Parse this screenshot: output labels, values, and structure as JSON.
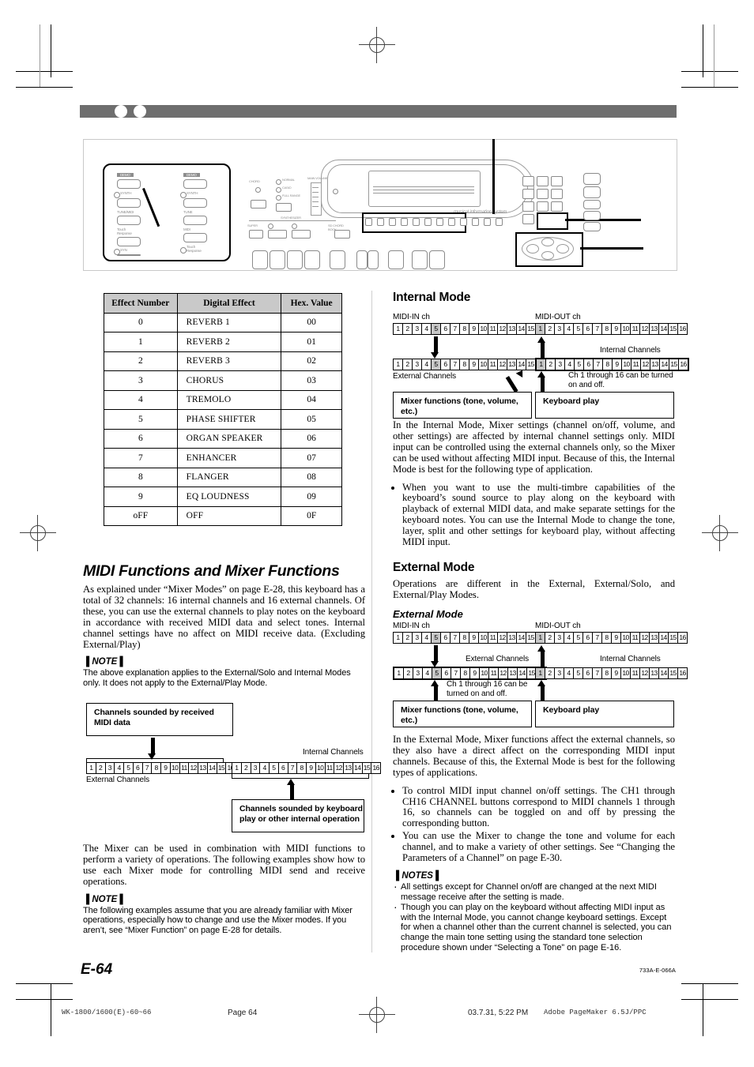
{
  "page": {
    "number_label": "E-64",
    "doc_ref": "733A-E-066A"
  },
  "footer": {
    "filename": "WK-1800/1600(E)-60~66",
    "page_label": "Page 64",
    "timestamp": "03.7.31, 5:22 PM",
    "software": "Adobe PageMaker 6.5J/PPC"
  },
  "effect_table": {
    "headers": [
      "Effect Number",
      "Digital Effect",
      "Hex. Value"
    ],
    "rows": [
      [
        "0",
        "REVERB 1",
        "00"
      ],
      [
        "1",
        "REVERB 2",
        "01"
      ],
      [
        "2",
        "REVERB 3",
        "02"
      ],
      [
        "3",
        "CHORUS",
        "03"
      ],
      [
        "4",
        "TREMOLO",
        "04"
      ],
      [
        "5",
        "PHASE SHIFTER",
        "05"
      ],
      [
        "6",
        "ORGAN SPEAKER",
        "06"
      ],
      [
        "7",
        "ENHANCER",
        "07"
      ],
      [
        "8",
        "FLANGER",
        "08"
      ],
      [
        "9",
        "EQ LOUDNESS",
        "09"
      ],
      [
        "oFF",
        "OFF",
        "0F"
      ]
    ]
  },
  "left_column": {
    "heading": "MIDI Functions and Mixer Functions",
    "intro": "As explained under “Mixer Modes” on page E-28, this keyboard has a total of 32 channels: 16 internal channels and 16 external channels. Of these, you can use the external channels to play notes on the keyboard in accordance with received MIDI data and select tones. Internal channel settings have no affect on MIDI receive data. (Excluding External/Play)",
    "note1_title": "▐ NOTE ▌",
    "note1_body": "The above explanation applies to the External/Solo and Internal Modes only. It does not apply to the External/Play Mode.",
    "diagram": {
      "top_box": "Channels sounded by received\nMIDI data",
      "bottom_box": "Channels sounded by keyboard\nplay or other internal operation",
      "external_label": "External Channels",
      "internal_label": "Internal Channels",
      "channels": [
        "1",
        "2",
        "3",
        "4",
        "5",
        "6",
        "7",
        "8",
        "9",
        "10",
        "11",
        "12",
        "13",
        "14",
        "15",
        "16"
      ]
    },
    "body2": "The Mixer can be used in combination with MIDI functions to perform a variety of operations. The following examples show how to use each Mixer mode for controlling MIDI send and receive operations.",
    "note2_title": "▐ NOTE ▌",
    "note2_body": "The following examples assume that you are already familiar with Mixer operations, especially how to change and use the Mixer modes. If you aren’t, see “Mixer Function” on page E-28 for details."
  },
  "internal_mode": {
    "heading": "Internal Mode",
    "diagram": {
      "midi_in_label": "MIDI-IN ch",
      "midi_out_label": "MIDI-OUT ch",
      "external_label": "External Channels",
      "internal_label": "Internal Channels",
      "note_text": "Ch 1 through 16 can be turned\non and off.",
      "mixer_box": "Mixer functions\n(tone, volume, etc.)",
      "keyboard_box": "Keyboard play",
      "channels": [
        "1",
        "2",
        "3",
        "4",
        "5",
        "6",
        "7",
        "8",
        "9",
        "10",
        "11",
        "12",
        "13",
        "14",
        "15",
        "16"
      ],
      "highlight_in": 5,
      "highlight_out": 1,
      "thick_row": "internal"
    },
    "body": "In the Internal Mode, Mixer settings (channel on/off, volume, and other settings) are affected by internal channel settings only. MIDI input can be controlled using the external channels only, so the Mixer can be used without affecting MIDI input. Because of this, the Internal Mode is best for the following type of application.",
    "bullets": [
      "When you want to use the multi-timbre capabilities of the keyboard’s sound source to play along on the keyboard with playback of external MIDI data, and make separate settings for the keyboard notes. You can use the Internal Mode to change the tone, layer, split and other settings for keyboard play, without affecting MIDI input."
    ]
  },
  "external_mode": {
    "heading": "External Mode",
    "intro": "Operations are different in the External, External/Solo, and External/Play Modes.",
    "subheading": "External Mode",
    "diagram": {
      "midi_in_label": "MIDI-IN ch",
      "midi_out_label": "MIDI-OUT ch",
      "external_label": "External Channels",
      "internal_label": "Internal Channels",
      "note_text": "Ch 1 through 16 can be\nturned on and off.",
      "mixer_box": "Mixer functions\n(tone, volume, etc.)",
      "keyboard_box": "Keyboard play",
      "channels": [
        "1",
        "2",
        "3",
        "4",
        "5",
        "6",
        "7",
        "8",
        "9",
        "10",
        "11",
        "12",
        "13",
        "14",
        "15",
        "16"
      ],
      "highlight_in": 5,
      "highlight_out": 1,
      "thick_row": "external"
    },
    "body": "In the External Mode, Mixer functions affect the external channels, so they also have a direct affect on the corresponding MIDI input channels. Because of this, the External Mode is best for the following types of applications.",
    "bullets": [
      "To control MIDI input channel on/off settings. The CH1 through CH16 CHANNEL buttons correspond to MIDI channels 1 through 16, so channels can be toggled on and off by pressing the corresponding button.",
      "You can use the Mixer to change the tone and volume for each channel, and to make a variety of other settings. See “Changing the Parameters of a Channel” on page E-30."
    ],
    "notes_title": "▐ NOTES ▌",
    "notes": [
      "All settings except for Channel on/off are changed at the next MIDI message receive after the setting is made.",
      "Though you can play on the keyboard without affecting MIDI input as with the Internal Mode, you cannot change keyboard settings. Except for when a channel other than the current channel is selected, you can change the main tone setting using the standard tone selection procedure shown under “Selecting a Tone” on page E-16."
    ]
  },
  "illustration": {
    "caption_left_labels": [
      "DEMO",
      "SYNTH",
      "TUNE/MIDI",
      "Touch Response",
      "SYN"
    ],
    "caption_right_labels": [
      "DEMO",
      "SYNTH",
      "TUNE",
      "MIDI",
      "Touch Response"
    ],
    "brand_text": "musical information system"
  },
  "colors": {
    "banner": "#6e6e6e",
    "table_header": "#c9c9c9",
    "highlight_cell": "#c7c7c7",
    "rule": "#cfcfcf"
  }
}
